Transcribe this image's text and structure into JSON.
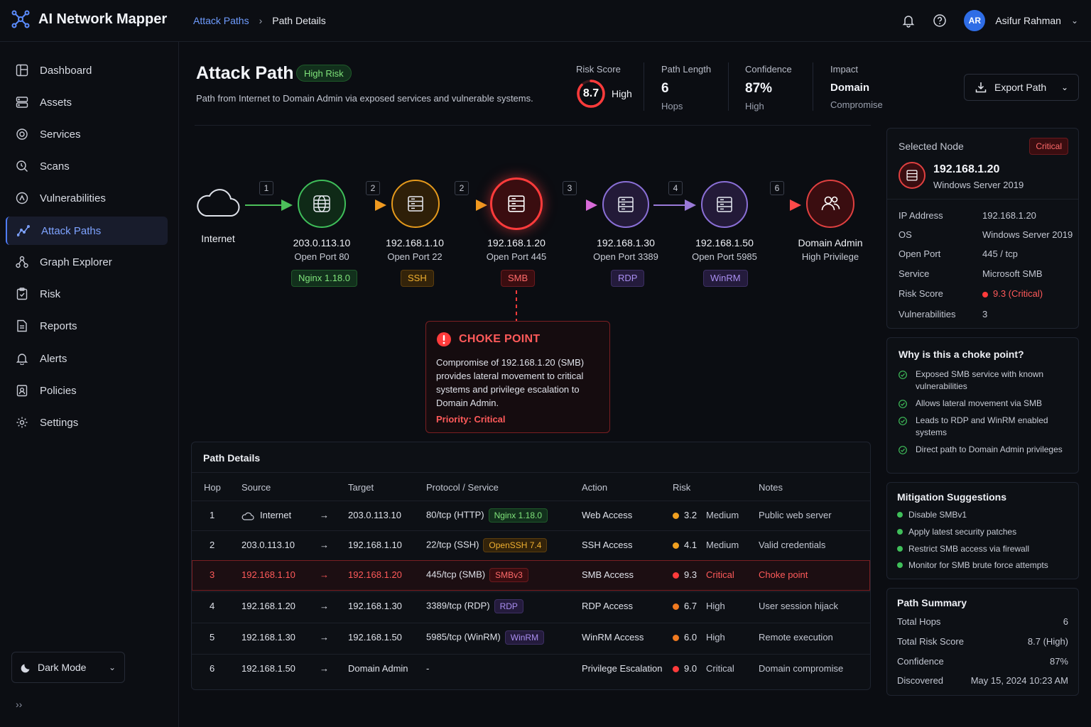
{
  "app": {
    "title": "AI Network Mapper"
  },
  "breadcrumb": {
    "parent": "Attack Paths",
    "current": "Path Details"
  },
  "user": {
    "initials": "AR",
    "name": "Asifur Rahman"
  },
  "sidebar": {
    "items": [
      {
        "label": "Dashboard",
        "icon": "dashboard-icon"
      },
      {
        "label": "Assets",
        "icon": "assets-icon"
      },
      {
        "label": "Services",
        "icon": "services-icon"
      },
      {
        "label": "Scans",
        "icon": "scans-icon"
      },
      {
        "label": "Vulnerabilities",
        "icon": "vulnerabilities-icon"
      },
      {
        "label": "Attack Paths",
        "icon": "attack-paths-icon",
        "active": true
      },
      {
        "label": "Graph Explorer",
        "icon": "graph-icon"
      },
      {
        "label": "Risk",
        "icon": "risk-icon"
      },
      {
        "label": "Reports",
        "icon": "reports-icon"
      },
      {
        "label": "Alerts",
        "icon": "bell-icon"
      },
      {
        "label": "Policies",
        "icon": "policies-icon"
      },
      {
        "label": "Settings",
        "icon": "gear-icon"
      }
    ],
    "dark_mode_label": "Dark Mode"
  },
  "header": {
    "title": "Attack Path",
    "risk_badge": "High Risk",
    "subtitle": "Path from Internet to Domain Admin via exposed services and vulnerable systems.",
    "risk_score": {
      "label": "Risk Score",
      "value": "8.7",
      "level": "High",
      "fraction": 0.87
    },
    "path_length": {
      "label": "Path Length",
      "value": "6",
      "unit": "Hops"
    },
    "confidence": {
      "label": "Confidence",
      "value": "87%",
      "level": "High"
    },
    "impact": {
      "label": "Impact",
      "value": "Domain",
      "sub": "Compromise"
    },
    "export_label": "Export Path"
  },
  "graph": {
    "source": {
      "label": "Internet"
    },
    "hops": [
      "1",
      "2",
      "2",
      "3",
      "4",
      "6"
    ],
    "nodes": [
      {
        "ip": "203.0.113.10",
        "port": "Open Port 80",
        "tag": "Nginx 1.18.0",
        "color": "#3fbf5a"
      },
      {
        "ip": "192.168.1.10",
        "port": "Open Port 22",
        "tag": "SSH",
        "color": "#e59a1c"
      },
      {
        "ip": "192.168.1.20",
        "port": "Open Port 445",
        "tag": "SMB",
        "color": "#ff3b3b"
      },
      {
        "ip": "192.168.1.30",
        "port": "Open Port 3389",
        "tag": "RDP",
        "color": "#8a6fd6"
      },
      {
        "ip": "192.168.1.50",
        "port": "Open Port 5985",
        "tag": "WinRM",
        "color": "#8a6fd6"
      },
      {
        "ip": "Domain Admin",
        "port": "High Privilege",
        "tag": "",
        "color": "#e04040"
      }
    ]
  },
  "choke": {
    "title": "CHOKE POINT",
    "text": "Compromise of 192.168.1.20 (SMB) provides lateral movement to critical systems and privilege escalation to Domain Admin.",
    "priority": "Priority: Critical"
  },
  "details": {
    "title": "Path Details",
    "columns": [
      "Hop",
      "Source",
      "Target",
      "Protocol / Service",
      "Action",
      "Risk",
      "Notes"
    ],
    "rows": [
      {
        "hop": "1",
        "source": "Internet",
        "target": "203.0.113.10",
        "protocol": "80/tcp (HTTP)",
        "tag": "Nginx 1.18.0",
        "action": "Web Access",
        "score": "3.2",
        "level": "Medium",
        "notes": "Public web server"
      },
      {
        "hop": "2",
        "source": "203.0.113.10",
        "target": "192.168.1.10",
        "protocol": "22/tcp (SSH)",
        "tag": "OpenSSH 7.4",
        "action": "SSH Access",
        "score": "4.1",
        "level": "Medium",
        "notes": "Valid credentials"
      },
      {
        "hop": "3",
        "source": "192.168.1.10",
        "target": "192.168.1.20",
        "protocol": "445/tcp (SMB)",
        "tag": "SMBv3",
        "action": "SMB Access",
        "score": "9.3",
        "level": "Critical",
        "notes": "Choke point"
      },
      {
        "hop": "4",
        "source": "192.168.1.20",
        "target": "192.168.1.30",
        "protocol": "3389/tcp (RDP)",
        "tag": "RDP",
        "action": "RDP Access",
        "score": "6.7",
        "level": "High",
        "notes": "User session hijack"
      },
      {
        "hop": "5",
        "source": "192.168.1.30",
        "target": "192.168.1.50",
        "protocol": "5985/tcp (WinRM)",
        "tag": "WinRM",
        "action": "WinRM Access",
        "score": "6.0",
        "level": "High",
        "notes": "Remote execution"
      },
      {
        "hop": "6",
        "source": "192.168.1.50",
        "target": "Domain Admin",
        "protocol": "-",
        "tag": "",
        "action": "Privilege Escalation",
        "score": "9.0",
        "level": "Critical",
        "notes": "Domain compromise"
      }
    ]
  },
  "selected_node": {
    "title": "Selected Node",
    "badge": "Critical",
    "ip": "192.168.1.20",
    "os_sub": "Windows Server 2019",
    "fields": [
      {
        "k": "IP Address",
        "v": "192.168.1.20"
      },
      {
        "k": "OS",
        "v": "Windows Server 2019"
      },
      {
        "k": "Open Port",
        "v": "445 / tcp"
      },
      {
        "k": "Service",
        "v": "Microsoft SMB"
      },
      {
        "k": "Risk Score",
        "v": "9.3 (Critical)"
      },
      {
        "k": "Vulnerabilities",
        "v": "3"
      }
    ]
  },
  "why": {
    "title": "Why is this a choke point?",
    "items": [
      "Exposed SMB service with known vulnerabilities",
      "Allows lateral movement via SMB",
      "Leads to RDP and WinRM enabled systems",
      "Direct path to Domain Admin privileges"
    ]
  },
  "mitigation": {
    "title": "Mitigation Suggestions",
    "items": [
      "Disable SMBv1",
      "Apply latest security patches",
      "Restrict SMB access via firewall",
      "Monitor for SMB brute force attempts"
    ]
  },
  "summary": {
    "title": "Path Summary",
    "rows": [
      {
        "k": "Total Hops",
        "v": "6"
      },
      {
        "k": "Total Risk Score",
        "v": "8.7 (High)"
      },
      {
        "k": "Confidence",
        "v": "87%"
      },
      {
        "k": "Discovered",
        "v": "May 15, 2024 10:23 AM"
      }
    ]
  },
  "colors": {
    "accent": "#4f7dff",
    "critical": "#ff3b3b",
    "medium": "#f0a020",
    "success": "#3fbf5a"
  }
}
